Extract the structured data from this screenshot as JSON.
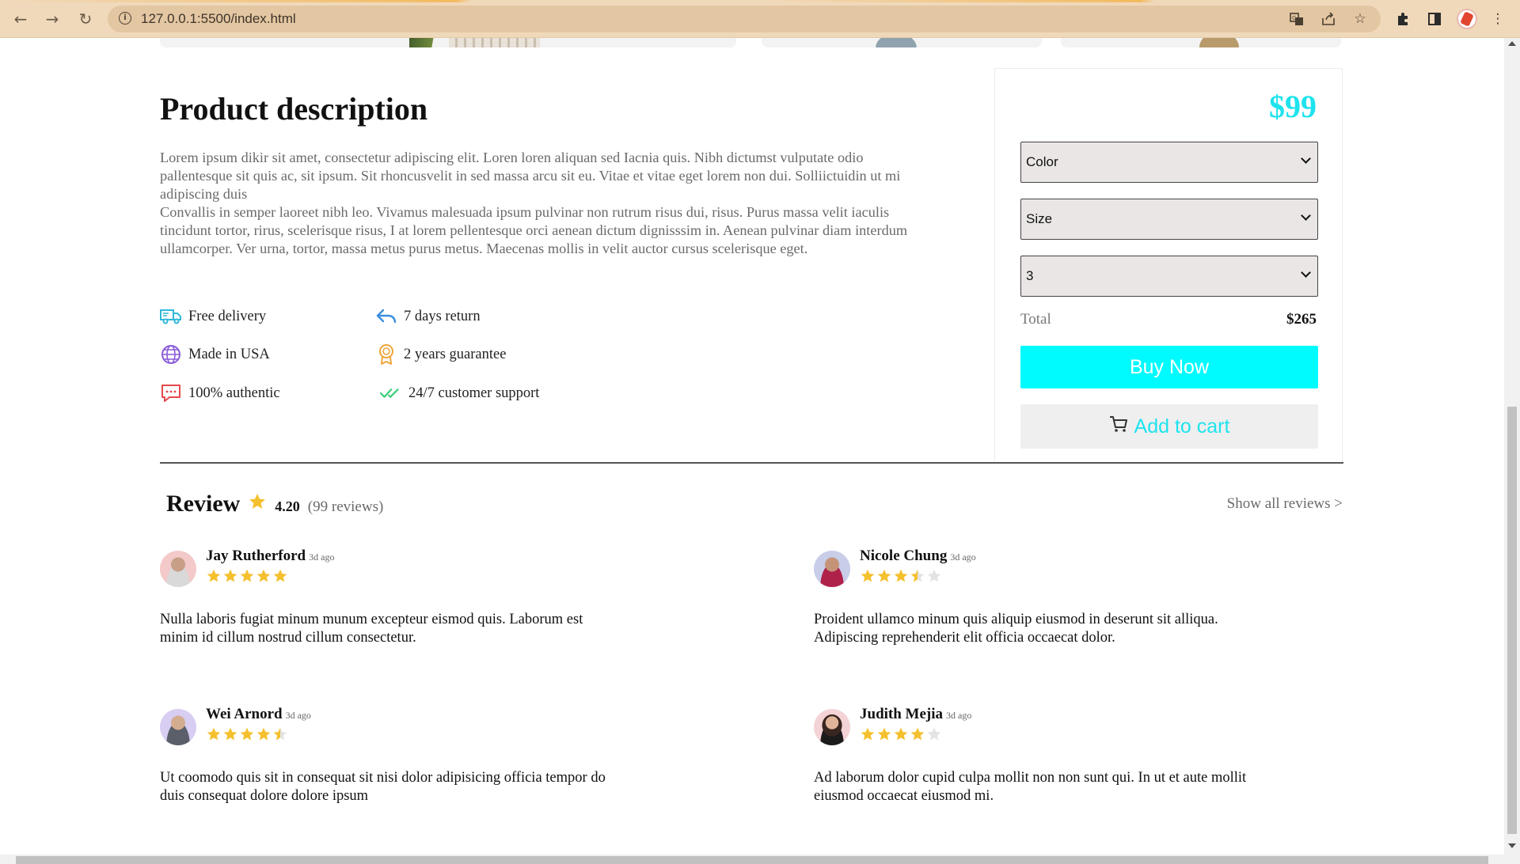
{
  "browser": {
    "url": "127.0.0.1:5500/index.html"
  },
  "product": {
    "title": "Product description",
    "paragraph1": "Lorem ipsum dikir sit amet, consectetur adipiscing elit. Loren loren aliquan sed Iacnia quis. Nibh dictumst vulputate odio pallentesque sit quis ac, sit ipsum. Sit rhoncusvelit in sed massa arcu sit eu. Vitae et vitae eget lorem non dui. Solliictuidin ut mi adipiscing duis",
    "paragraph2": "Convallis in semper laoreet nibh leo. Vivamus malesuada ipsum pulvinar non rutrum risus dui, risus. Purus massa velit iaculis tincidunt tortor, rirus, scelerisque risus, I at lorem pellentesque orci aenean dictum dignisssim in. Aenean pulvinar diam interdum ullamcorper. Ver urna, tortor, massa metus purus metus. Maecenas mollis in velit auctor cursus scelerisque eget.",
    "features": [
      {
        "label": "Free delivery",
        "icon": "truck-icon"
      },
      {
        "label": "7 days return",
        "icon": "return-arrow-icon"
      },
      {
        "label": "Made in USA",
        "icon": "globe-icon"
      },
      {
        "label": "2 years guarantee",
        "icon": "award-icon"
      },
      {
        "label": "100% authentic",
        "icon": "chat-icon"
      },
      {
        "label": "24/7 customer support",
        "icon": "double-check-icon"
      }
    ]
  },
  "purchase": {
    "price": "$99",
    "color_select": "Color",
    "size_select": "Size",
    "quantity_select": "3",
    "total_label": "Total",
    "total_value": "$265",
    "buy_label": "Buy Now",
    "cart_label": "Add to cart",
    "accent_color": "#00fbff"
  },
  "reviews": {
    "title": "Review",
    "rating": "4.20",
    "count": "(99 reviews)",
    "show_all": "Show all reviews >",
    "items": [
      {
        "name": "Jay Rutherford",
        "ago": "3d ago",
        "stars": 5,
        "text": "Nulla laboris fugiat minum munum excepteur eismod quis. Laborum est minim id cillum nostrud cillum consectetur."
      },
      {
        "name": "Nicole Chung",
        "ago": "3d ago",
        "stars": 3.5,
        "text": "Proident ullamco minum quis aliquip eiusmod in deserunt sit alliqua. Adipiscing reprehenderit elit officia occaecat dolor."
      },
      {
        "name": "Wei Arnord",
        "ago": "3d ago",
        "stars": 4.5,
        "text": "Ut coomodo quis sit in consequat sit nisi dolor adipisicing officia tempor do duis consequat dolore dolore ipsum"
      },
      {
        "name": "Judith Mejia",
        "ago": "3d ago",
        "stars": 4,
        "text": "Ad laborum dolor cupid culpa mollit non non sunt qui. In ut et aute mollit eiusmod occaecat eiusmod mi."
      }
    ]
  }
}
